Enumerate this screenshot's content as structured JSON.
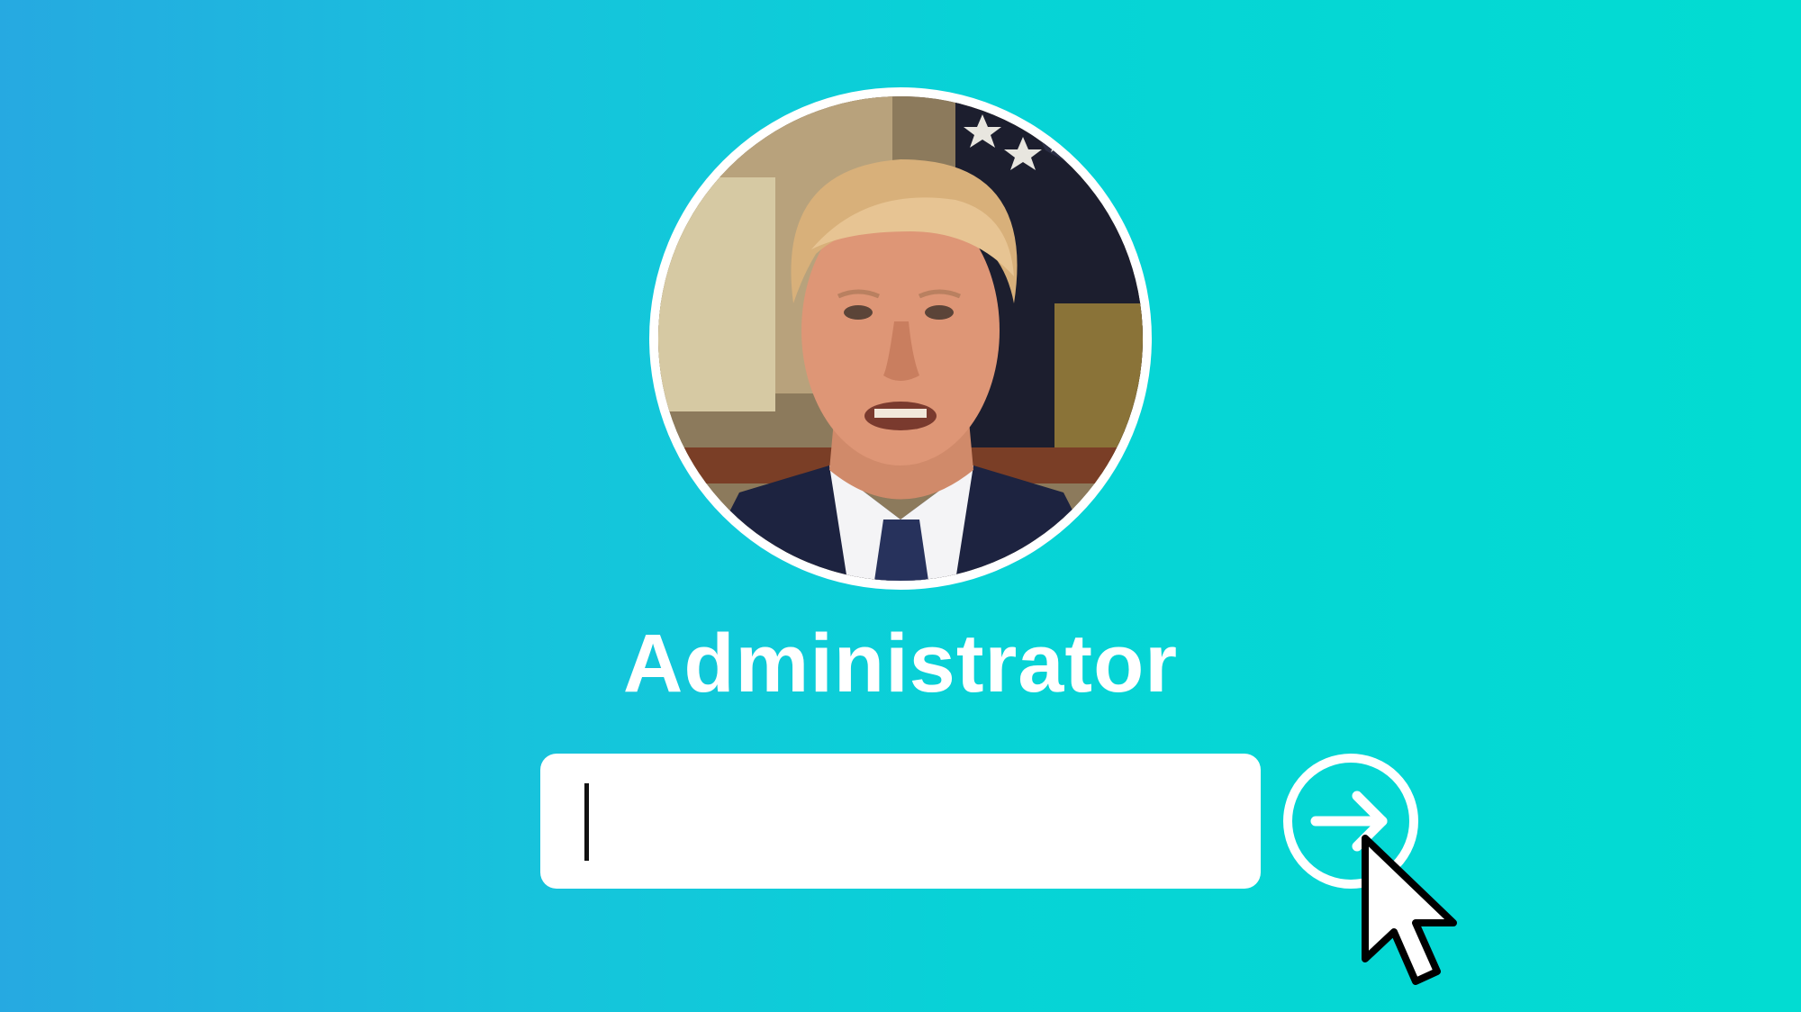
{
  "user": {
    "name": "Administrator",
    "avatar_icon": "user-avatar-photo"
  },
  "password": {
    "value": "",
    "placeholder": ""
  },
  "submit": {
    "icon": "arrow-right-icon"
  },
  "colors": {
    "background_left": "#26a9e1",
    "background_right": "#02dcd2",
    "field": "#ffffff",
    "text": "#ffffff"
  }
}
